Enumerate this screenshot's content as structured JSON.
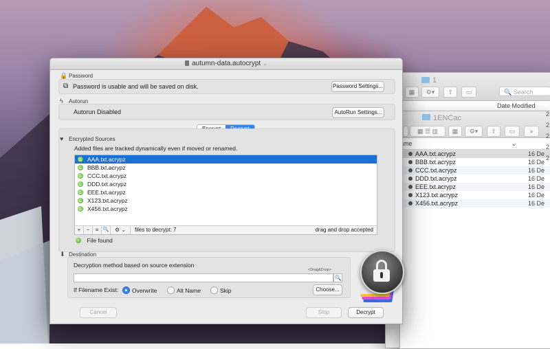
{
  "window": {
    "title": "autumn-data.autocrypt"
  },
  "password": {
    "heading": "Password",
    "status": "Password is usable and will be saved on disk.",
    "button": "Password Settings..."
  },
  "autorun": {
    "heading": "Autorun",
    "status": "Autorun Disabled",
    "button": "AutoRun Settings..."
  },
  "mode_tabs": [
    "Encrypt",
    "Decrypt"
  ],
  "mode_selected": "Decrypt",
  "sources": {
    "heading": "Encrypted Sources",
    "note": "Added files are tracked dynamically  even if moved or renamed.",
    "files": [
      "AAA.txt.acrypz",
      "BBB.txt.acrypz",
      "CCC.txt.acrypz",
      "DDD.txt.acrypz",
      "EEE.txt.acrypz",
      "X123.txt.acrypz",
      "X456.txt.acrypz"
    ],
    "selected_index": 0,
    "toolbar": {
      "add": "+",
      "remove": "−",
      "list": "≡",
      "search": "🔍",
      "action": "⚙",
      "count": "files to decrypt: 7",
      "dragdrop": "drag and drop accepted"
    },
    "file_status": "File found"
  },
  "destination": {
    "heading": "Destination",
    "method": "Decryption method based on source extension",
    "drop_hint": "<Drag&Drop>",
    "path_value": "",
    "exists_label": "If Filename Exist:",
    "options": [
      "Overwrite",
      "Alt Name",
      "Skip"
    ],
    "option_selected": "Overwrite",
    "choose_button": "Choose..."
  },
  "footer": {
    "cancel": "Cancel",
    "stop": "Stop",
    "decrypt": "Decrypt"
  },
  "finder_back": {
    "title": "1",
    "search_placeholder": "Search",
    "col_date": "Date Modified",
    "numbers": [
      "2",
      "2",
      "2",
      "2",
      "2"
    ]
  },
  "finder_front": {
    "title": "1ENCac",
    "col_name": "ame",
    "files": [
      "AAA.txt.acrypz",
      "BBB.txt.acrypz",
      "CCC.txt.acrypz",
      "DDD.txt.acrypz",
      "EEE.txt.acrypz",
      "X123.txt.acrypz",
      "X456.txt.acrypz"
    ],
    "date": "16 De"
  }
}
